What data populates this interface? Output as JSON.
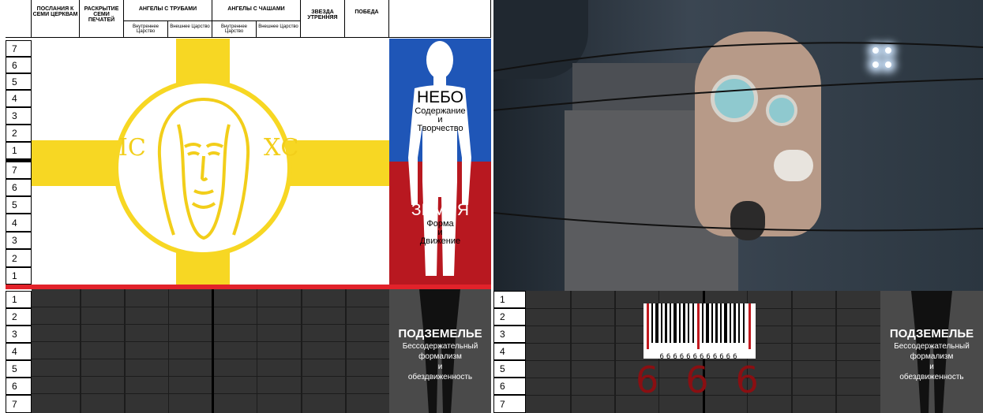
{
  "left": {
    "headers": [
      {
        "label": "ПОСЛАНИЯ К СЕМИ ЦЕРКВАМ"
      },
      {
        "label": "РАСКРЫТИЕ СЕМИ ПЕЧАТЕЙ"
      },
      {
        "label": "АНГЕЛЫ С ТРУБАМИ",
        "sub": [
          "Внутреннее Царство",
          "Внешнее Царство"
        ]
      },
      {
        "label": "АНГЕЛЫ С ЧАШАМИ",
        "sub": [
          "Внутреннее Царство",
          "Внешнее Царство"
        ]
      },
      {
        "label": "ЗВЕЗДА УТРЕННЯЯ"
      },
      {
        "label": "ПОБЕДА"
      }
    ],
    "rows_top": [
      "7",
      "6",
      "5",
      "4",
      "3",
      "2",
      "1"
    ],
    "rows_mid": [
      "7",
      "6",
      "5",
      "4",
      "3",
      "2",
      "1"
    ],
    "rows_bottom": [
      "1",
      "2",
      "3",
      "4",
      "5",
      "6",
      "7"
    ],
    "icon_left": "ІС",
    "icon_right": "ХС",
    "sky": {
      "title": "НЕБО",
      "line1": "Содержание",
      "line2": "и",
      "line3": "Творчество"
    },
    "earth": {
      "title": "ЗЕМЛЯ",
      "line1": "Форма",
      "line2": "и",
      "line3": "Движение"
    },
    "underworld": {
      "title": "ПОДЗЕМЕЛЬЕ",
      "line1": "Бессодержательный",
      "line2": "формализм",
      "line3": "и",
      "line4": "обездвиженность"
    }
  },
  "right": {
    "rows_bottom": [
      "1",
      "2",
      "3",
      "4",
      "5",
      "6",
      "7"
    ],
    "barcode_digits": "666666666666",
    "number": "666",
    "underworld": {
      "title": "ПОДЗЕМЕЛЬЕ",
      "line1": "Бессодержательный",
      "line2": "формализм",
      "line3": "и",
      "line4": "обездвиженность"
    }
  },
  "colors": {
    "yellow": "#f7d723",
    "blue": "#1f56b7",
    "red": "#b81820",
    "dark": "#333333"
  }
}
